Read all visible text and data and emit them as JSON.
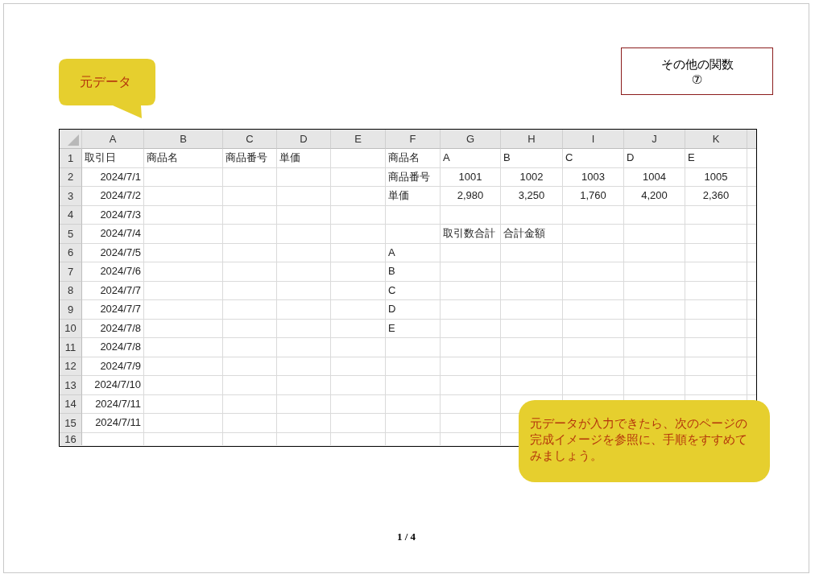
{
  "page": {
    "label_callout": {
      "text": "元データ"
    },
    "title_box": {
      "lines": [
        "その他の関数",
        "⑦"
      ]
    },
    "sheet": {
      "columns": [
        "A",
        "B",
        "C",
        "D",
        "E",
        "F",
        "G",
        "H",
        "I",
        "J",
        "K"
      ],
      "rows": [
        {
          "number": "1",
          "cells": {
            "A": {
              "kind": "text",
              "text": "取引日"
            },
            "B": {
              "kind": "text",
              "text": "商品名"
            },
            "C": {
              "kind": "text",
              "text": "商品番号"
            },
            "D": {
              "kind": "text",
              "text": "単価"
            },
            "F": {
              "kind": "text",
              "text": "商品名"
            },
            "G": {
              "kind": "text",
              "text": "A"
            },
            "H": {
              "kind": "text",
              "text": "B"
            },
            "I": {
              "kind": "text",
              "text": "C"
            },
            "J": {
              "kind": "text",
              "text": "D"
            },
            "K": {
              "kind": "text",
              "text": "E"
            }
          }
        },
        {
          "number": "2",
          "cells": {
            "A": {
              "kind": "date",
              "text": "2024/7/1"
            },
            "F": {
              "kind": "text",
              "text": "商品番号"
            },
            "G": {
              "kind": "number",
              "text": "1001"
            },
            "H": {
              "kind": "number",
              "text": "1002"
            },
            "I": {
              "kind": "number",
              "text": "1003"
            },
            "J": {
              "kind": "number",
              "text": "1004"
            },
            "K": {
              "kind": "number",
              "text": "1005"
            }
          }
        },
        {
          "number": "3",
          "cells": {
            "A": {
              "kind": "date",
              "text": "2024/7/2"
            },
            "F": {
              "kind": "text",
              "text": "単価"
            },
            "G": {
              "kind": "number",
              "text": "2,980"
            },
            "H": {
              "kind": "number",
              "text": "3,250"
            },
            "I": {
              "kind": "number",
              "text": "1,760"
            },
            "J": {
              "kind": "number",
              "text": "4,200"
            },
            "K": {
              "kind": "number",
              "text": "2,360"
            }
          }
        },
        {
          "number": "4",
          "cells": {
            "A": {
              "kind": "date",
              "text": "2024/7/3"
            }
          }
        },
        {
          "number": "5",
          "cells": {
            "A": {
              "kind": "date",
              "text": "2024/7/4"
            },
            "G": {
              "kind": "text",
              "text": "取引数合計"
            },
            "H": {
              "kind": "text",
              "text": "合計金額"
            }
          }
        },
        {
          "number": "6",
          "cells": {
            "A": {
              "kind": "date",
              "text": "2024/7/5"
            },
            "F": {
              "kind": "text",
              "text": "A"
            }
          }
        },
        {
          "number": "7",
          "cells": {
            "A": {
              "kind": "date",
              "text": "2024/7/6"
            },
            "F": {
              "kind": "text",
              "text": "B"
            }
          }
        },
        {
          "number": "8",
          "cells": {
            "A": {
              "kind": "date",
              "text": "2024/7/7"
            },
            "F": {
              "kind": "text",
              "text": "C"
            }
          }
        },
        {
          "number": "9",
          "cells": {
            "A": {
              "kind": "date",
              "text": "2024/7/7"
            },
            "F": {
              "kind": "text",
              "text": "D"
            }
          }
        },
        {
          "number": "10",
          "cells": {
            "A": {
              "kind": "date",
              "text": "2024/7/8"
            },
            "F": {
              "kind": "text",
              "text": "E"
            }
          }
        },
        {
          "number": "11",
          "cells": {
            "A": {
              "kind": "date",
              "text": "2024/7/8"
            }
          }
        },
        {
          "number": "12",
          "cells": {
            "A": {
              "kind": "date",
              "text": "2024/7/9"
            }
          }
        },
        {
          "number": "13",
          "cells": {
            "A": {
              "kind": "date",
              "text": "2024/7/10"
            }
          }
        },
        {
          "number": "14",
          "cells": {
            "A": {
              "kind": "date",
              "text": "2024/7/11"
            }
          }
        },
        {
          "number": "15",
          "cells": {
            "A": {
              "kind": "date",
              "text": "2024/7/11"
            }
          }
        },
        {
          "number": "16"
        }
      ]
    },
    "note_callout": {
      "text": "元データが入力できたら、次のページの完成イメージを参照に、手順をすすめてみましょう。"
    },
    "page_number": "1 / 4"
  }
}
